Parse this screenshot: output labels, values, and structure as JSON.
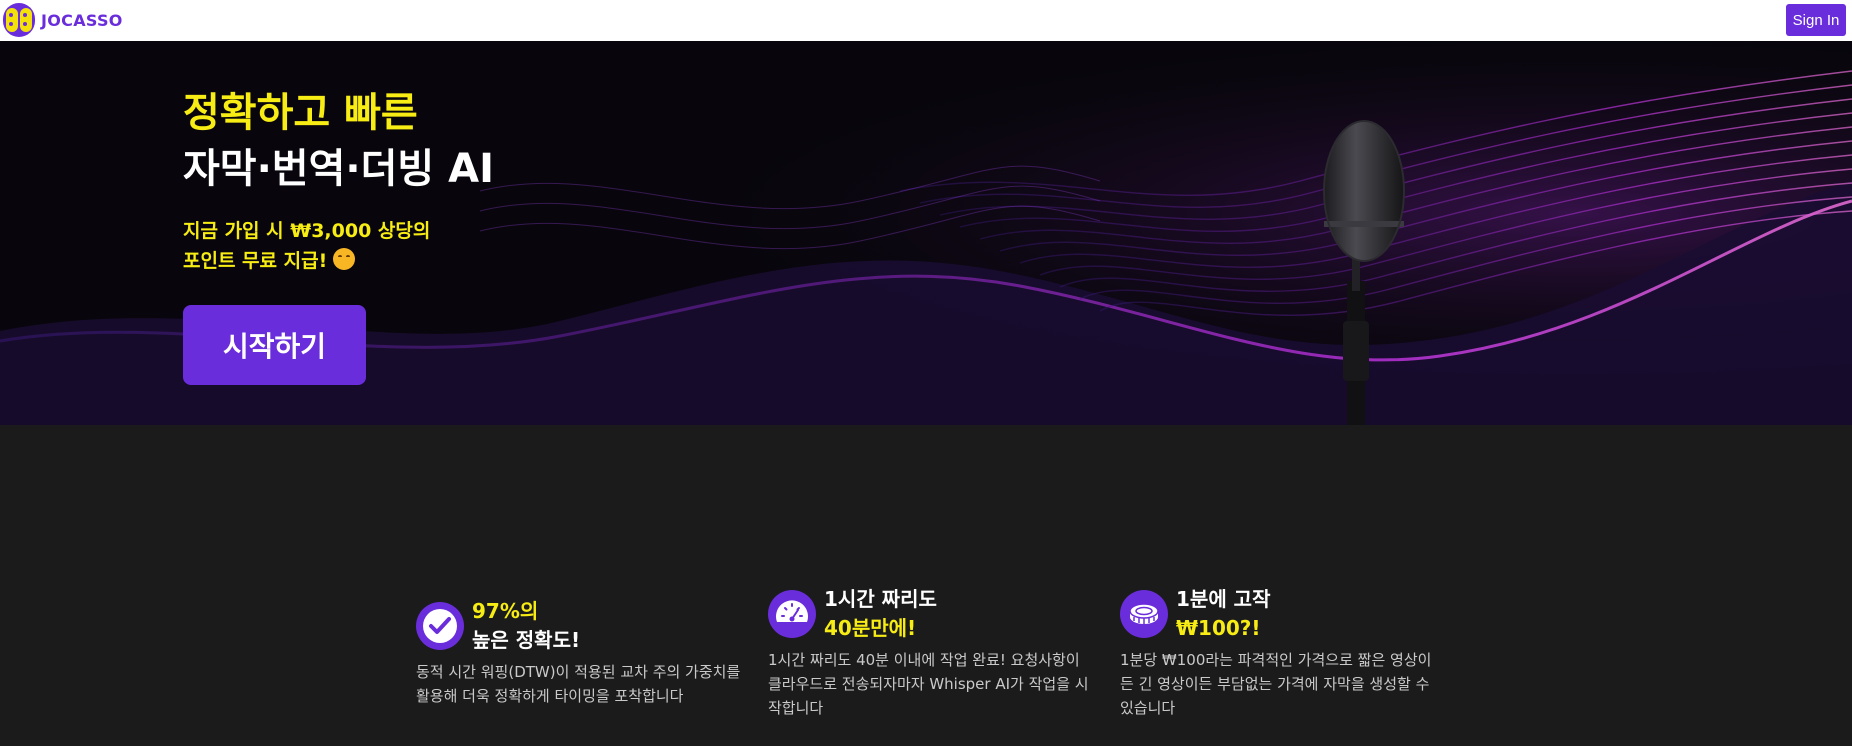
{
  "nav": {
    "brand": "JOCASSO",
    "logo_icon": "jocasso-logo-icon",
    "signin_label": "Sign In"
  },
  "hero": {
    "title_line1": "정확하고 빠른",
    "title_line2": "자막·번역·더빙 AI",
    "subtitle_line1": "지금 가입 시 ₩3,000 상당의",
    "subtitle_line2": "포인트 무료 지급!",
    "subtitle_emoji": "hugging-face-emoji",
    "cta_label": "시작하기",
    "background_icon": "microphone-soundwave-image"
  },
  "features": [
    {
      "icon": "check-circle-icon",
      "head_a": "97%의",
      "head_b": "높은 정확도!",
      "desc": "동적 시간 워핑(DTW)이 적용된 교차 주의 가중치를 활용해 더욱 정확하게 타이밍을 포착합니다"
    },
    {
      "icon": "speedometer-icon",
      "head_a": "1시간 짜리도",
      "head_b": "40분만에!",
      "desc": "1시간 짜리도 40분 이내에 작업 완료! 요청사항이 클라우드로 전송되자마자 Whisper AI가 작업을 시작합니다"
    },
    {
      "icon": "coin-icon",
      "head_a": "1분에 고작",
      "head_b": "₩100?!",
      "desc": "1분당 ₩100라는 파격적인 가격으로 짧은 영상이든 긴 영상이든 부담없는 가격에 자막을 생성할 수 있습니다"
    }
  ],
  "colors": {
    "brand_purple": "#6a2ddb",
    "accent_yellow": "#f7ec13",
    "dark_bg": "#1b1b1b"
  }
}
